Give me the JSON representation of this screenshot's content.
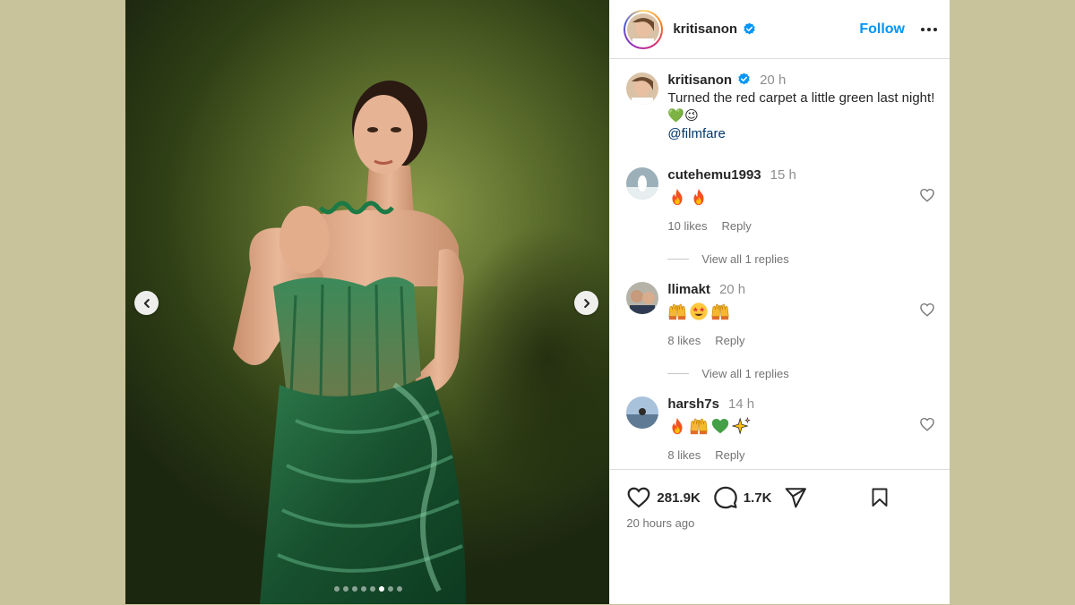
{
  "post": {
    "username": "kritisanon",
    "verified": true,
    "follow_label": "Follow",
    "more_icon": "more-options-icon",
    "media": {
      "slide_count": 8,
      "active_slide": 6,
      "prev_icon": "chevron-left-icon",
      "next_icon": "chevron-right-icon"
    },
    "caption": {
      "username": "kritisanon",
      "time": "20 h",
      "text": "Turned the red carpet a little green last night! 💚😉",
      "mention": "@filmfare"
    },
    "comments": [
      {
        "username": "cutehemu1993",
        "time": "15 h",
        "emojis": [
          "fire",
          "fire"
        ],
        "likes": "10 likes",
        "reply_label": "Reply",
        "view_replies": "View all 1 replies"
      },
      {
        "username": "llimakt",
        "time": "20 h",
        "emojis": [
          "raising-hands",
          "star-struck",
          "raising-hands"
        ],
        "likes": "8 likes",
        "reply_label": "Reply",
        "view_replies": "View all 1 replies"
      },
      {
        "username": "harsh7s",
        "time": "14 h",
        "emojis": [
          "fire",
          "raising-hands",
          "green-heart",
          "sparkles"
        ],
        "likes": "8 likes",
        "reply_label": "Reply"
      }
    ],
    "like_count": "281.9K",
    "comment_count": "1.7K",
    "time_ago": "20 hours ago"
  },
  "colors": {
    "link_blue": "#0095f6",
    "mention": "#00376b",
    "backdrop": "#c8c39b",
    "dress_green": "#1e5a35"
  }
}
